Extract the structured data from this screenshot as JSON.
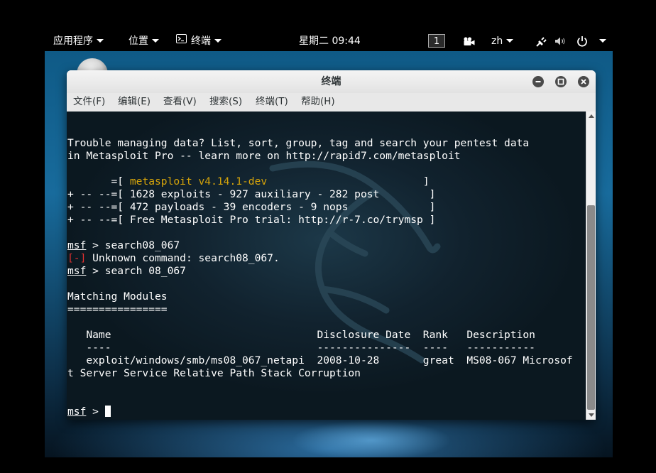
{
  "top_panel": {
    "applications": "应用程序",
    "places": "位置",
    "terminal_app": "终端",
    "clock": "星期二 09:44",
    "workspace": "1",
    "language": "zh",
    "icons": [
      "terminal-icon",
      "video-icon",
      "network-icon",
      "volume-icon",
      "power-icon"
    ]
  },
  "window": {
    "title": "终端",
    "menu": [
      "文件(F)",
      "编辑(E)",
      "查看(V)",
      "搜索(S)",
      "终端(T)",
      "帮助(H)"
    ]
  },
  "terminal": {
    "banner_line1": "Trouble managing data? List, sort, group, tag and search your pentest data",
    "banner_line2": "in Metasploit Pro -- learn more on http://rapid7.com/metasploit",
    "version_prefix": "       =[ ",
    "version": "metasploit v4.14.1-dev",
    "version_suffix": "                         ]",
    "stats1": "+ -- --=[ 1628 exploits - 927 auxiliary - 282 post        ]",
    "stats2": "+ -- --=[ 472 payloads - 39 encoders - 9 nops             ]",
    "stats3": "+ -- --=[ Free Metasploit Pro trial: http://r-7.co/trymsp ]",
    "prompt": "msf",
    "prompt_sep": " > ",
    "cmd1": "search08_067",
    "error_tag": "[-]",
    "error_text": " Unknown command: search08_067.",
    "cmd2": "search 08_067",
    "matching": "Matching Modules",
    "underline": "================",
    "header": "   Name                                 Disclosure Date  Rank   Description",
    "header_sep": "   ----                                 ---------------  ----   -----------",
    "row": "   exploit/windows/smb/ms08_067_netapi  2008-10-28       great  MS08-067 Microsof",
    "row_wrap": "t Server Service Relative Path Stack Corruption"
  },
  "colors": {
    "accent_yellow": "#d6a40a",
    "error_red": "#e03030",
    "terminal_bg": "#11222e"
  }
}
